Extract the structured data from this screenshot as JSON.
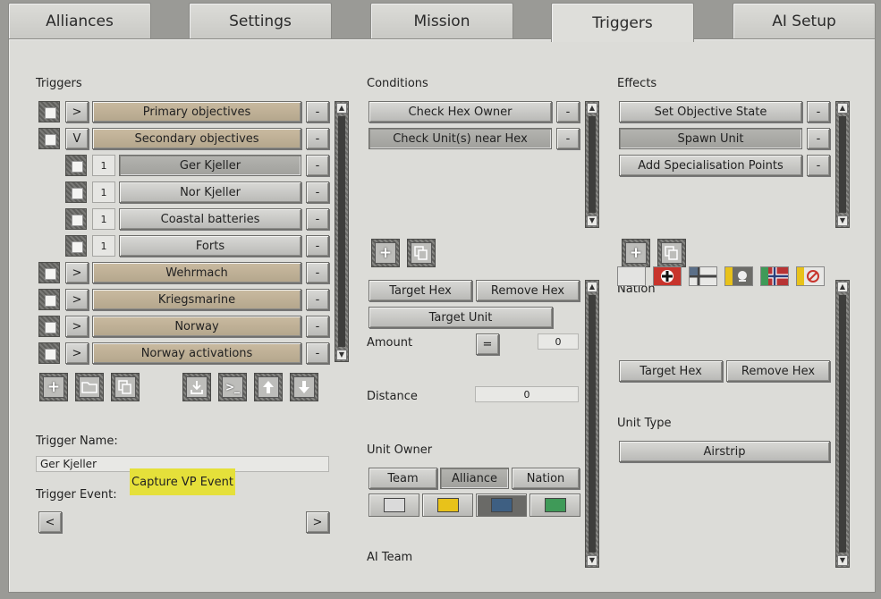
{
  "tabs": [
    {
      "label": "Alliances"
    },
    {
      "label": "Settings"
    },
    {
      "label": "Mission"
    },
    {
      "label": "Triggers"
    },
    {
      "label": "AI Setup"
    }
  ],
  "triggers": {
    "heading": "Triggers",
    "rows": [
      {
        "expander": ">",
        "label": "Primary objectives",
        "remove": "-"
      },
      {
        "expander": "V",
        "label": "Secondary objectives",
        "remove": "-"
      },
      {
        "expander": "1",
        "label": "Ger Kjeller",
        "remove": "-"
      },
      {
        "expander": "1",
        "label": "Nor Kjeller",
        "remove": "-"
      },
      {
        "expander": "1",
        "label": "Coastal batteries",
        "remove": "-"
      },
      {
        "expander": "1",
        "label": "Forts",
        "remove": "-"
      },
      {
        "expander": ">",
        "label": "Wehrmach",
        "remove": "-"
      },
      {
        "expander": ">",
        "label": "Kriegsmarine",
        "remove": "-"
      },
      {
        "expander": ">",
        "label": "Norway",
        "remove": "-"
      },
      {
        "expander": ">",
        "label": "Norway activations",
        "remove": "-"
      }
    ],
    "name_label": "Trigger Name:",
    "name_value": "Ger Kjeller",
    "event_label": "Trigger Event:",
    "event_prev": "<",
    "event_next": ">",
    "event_value": "Capture VP Event"
  },
  "conditions": {
    "heading": "Conditions",
    "items": [
      {
        "label": "Check Hex Owner",
        "remove": "-"
      },
      {
        "label": "Check Unit(s) near Hex",
        "remove": "-"
      }
    ],
    "target_hex": "Target Hex",
    "remove_hex": "Remove Hex",
    "target_unit": "Target Unit",
    "amount_label": "Amount",
    "amount_op": "=",
    "amount_value": "0",
    "distance_label": "Distance",
    "distance_value": "0",
    "unit_owner_label": "Unit Owner",
    "owner_team": "Team",
    "owner_alliance": "Alliance",
    "owner_nation": "Nation",
    "owner_colors": [
      "#dadada",
      "#e8c21a",
      "#3e5f82",
      "#3f9a58"
    ],
    "ai_team_label": "AI Team"
  },
  "effects": {
    "heading": "Effects",
    "items": [
      {
        "label": "Set Objective State",
        "remove": "-"
      },
      {
        "label": "Spawn Unit",
        "remove": "-"
      },
      {
        "label": "Add Specialisation Points",
        "remove": "-"
      }
    ],
    "nation_label": "Nation",
    "target_hex": "Target Hex",
    "remove_hex": "Remove Hex",
    "unit_type_label": "Unit Type",
    "unit_type_value": "Airstrip"
  },
  "colors": {
    "event_highlight": "#e5e03a",
    "tan_button": "#c0b197"
  }
}
